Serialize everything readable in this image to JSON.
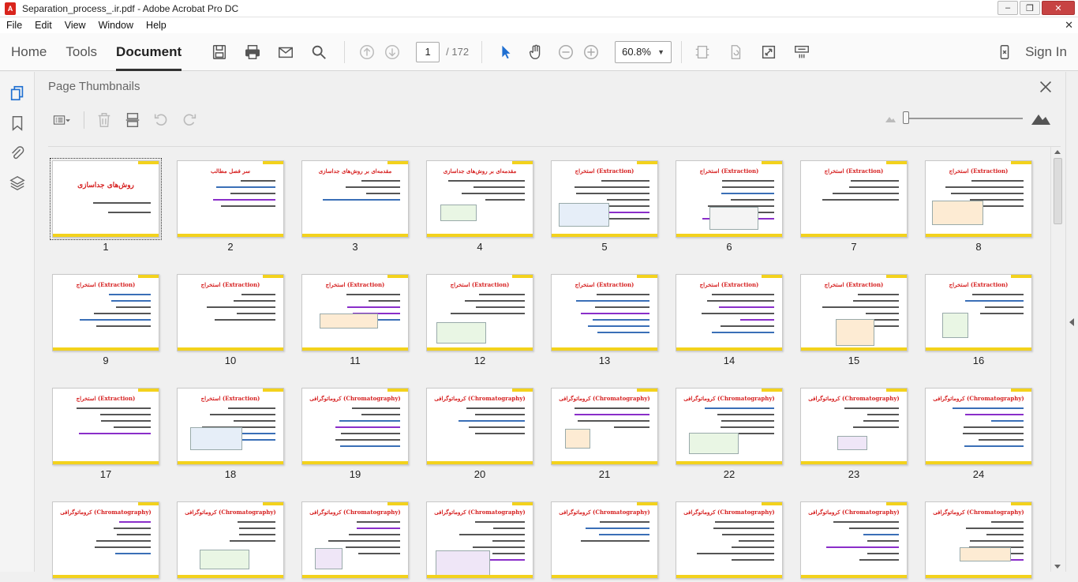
{
  "window": {
    "title": "Separation_process_.ir.pdf - Adobe Acrobat Pro DC",
    "app_icon": "A",
    "min_label": "–",
    "max_label": "❐",
    "close_label": "✕"
  },
  "menu": {
    "items": [
      "File",
      "Edit",
      "View",
      "Window",
      "Help"
    ],
    "close_label": "✕"
  },
  "toolbar": {
    "tabs": [
      "Home",
      "Tools",
      "Document"
    ],
    "active_tab": "Document",
    "current_page": "1",
    "total_pages": "/ 172",
    "zoom": "60.8%",
    "signin_label": "Sign In"
  },
  "panel": {
    "title": "Page Thumbnails",
    "thumbnails": [
      {
        "page": "1",
        "heading": "روش‌های جداسازی"
      },
      {
        "page": "2",
        "heading": "سر فصل مطالب"
      },
      {
        "page": "3",
        "heading": "مقدمه‌ای بر روش‌های جداسازی"
      },
      {
        "page": "4",
        "heading": "مقدمه‌ای بر روش‌های جداسازی"
      },
      {
        "page": "5",
        "heading": "استخراج (Extraction)"
      },
      {
        "page": "6",
        "heading": "استخراج (Extraction)"
      },
      {
        "page": "7",
        "heading": "استخراج (Extraction)"
      },
      {
        "page": "8",
        "heading": "استخراج (Extraction)"
      },
      {
        "page": "9",
        "heading": "استخراج (Extraction)"
      },
      {
        "page": "10",
        "heading": "استخراج (Extraction)"
      },
      {
        "page": "11",
        "heading": "استخراج (Extraction)"
      },
      {
        "page": "12",
        "heading": "استخراج (Extraction)"
      },
      {
        "page": "13",
        "heading": "استخراج (Extraction)"
      },
      {
        "page": "14",
        "heading": "استخراج (Extraction)"
      },
      {
        "page": "15",
        "heading": "استخراج (Extraction)"
      },
      {
        "page": "16",
        "heading": "استخراج (Extraction)"
      },
      {
        "page": "17",
        "heading": "استخراج (Extraction)"
      },
      {
        "page": "18",
        "heading": "استخراج (Extraction)"
      },
      {
        "page": "19",
        "heading": "کروماتوگرافی (Chromatography)"
      },
      {
        "page": "20",
        "heading": "کروماتوگرافی (Chromatography)"
      },
      {
        "page": "21",
        "heading": "کروماتوگرافی (Chromatography)"
      },
      {
        "page": "22",
        "heading": "کروماتوگرافی (Chromatography)"
      },
      {
        "page": "23",
        "heading": "کروماتوگرافی (Chromatography)"
      },
      {
        "page": "24",
        "heading": "کروماتوگرافی (Chromatography)"
      },
      {
        "page": "",
        "heading": "کروماتوگرافی (Chromatography)"
      },
      {
        "page": "",
        "heading": "کروماتوگرافی (Chromatography)"
      },
      {
        "page": "",
        "heading": "کروماتوگرافی (Chromatography)"
      },
      {
        "page": "",
        "heading": "کروماتوگرافی (Chromatography)"
      },
      {
        "page": "",
        "heading": "کروماتوگرافی (Chromatography)"
      },
      {
        "page": "",
        "heading": "کروماتوگرافی (Chromatography)"
      },
      {
        "page": "",
        "heading": "کروماتوگرافی (Chromatography)"
      },
      {
        "page": "",
        "heading": "کروماتوگرافی (Chromatography)"
      }
    ]
  },
  "colors": {
    "heading_red": "#d62020",
    "band_yellow": "#f3d21c",
    "cursor_blue": "#1f6fd1"
  }
}
